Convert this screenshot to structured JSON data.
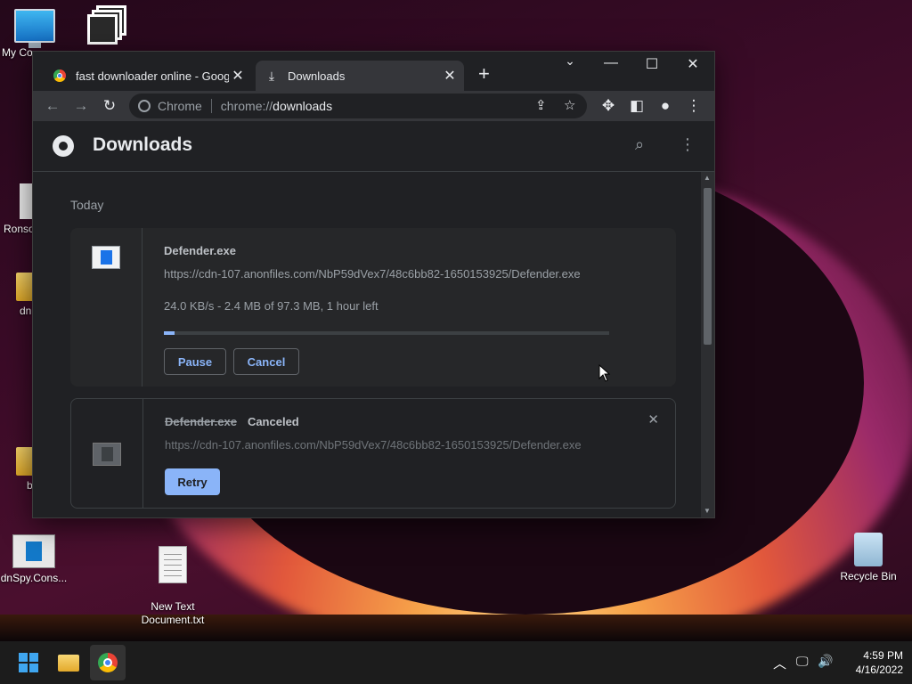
{
  "desktop": {
    "icons": [
      {
        "label": "My Co"
      },
      {
        "label": ""
      },
      {
        "label": "Ronso"
      },
      {
        "label": "dn"
      },
      {
        "label": "b"
      },
      {
        "label": "dnSpy.Cons..."
      },
      {
        "label": "New Text\nDocument.txt"
      },
      {
        "label": "Recycle Bin"
      }
    ]
  },
  "browser": {
    "tabs": [
      {
        "title": "fast downloader online - Google",
        "icon": "google-icon"
      },
      {
        "title": "Downloads",
        "icon": "download-icon"
      }
    ],
    "omnibox": {
      "site": "Chrome",
      "url_prefix": "chrome://",
      "url_path": "downloads"
    }
  },
  "downloads_page": {
    "title": "Downloads",
    "section": "Today",
    "items": [
      {
        "filename": "Defender.exe",
        "url": "https://cdn-107.anonfiles.com/NbP59dVex7/48c6bb82-1650153925/Defender.exe",
        "status": "24.0 KB/s - 2.4 MB of 97.3 MB, 1 hour left",
        "progress_fraction": 0.0247,
        "buttons": {
          "pause": "Pause",
          "cancel": "Cancel"
        }
      },
      {
        "filename": "Defender.exe",
        "state": "Canceled",
        "url": "https://cdn-107.anonfiles.com/NbP59dVex7/48c6bb82-1650153925/Defender.exe",
        "buttons": {
          "retry": "Retry"
        }
      }
    ]
  },
  "taskbar": {
    "time": "4:59 PM",
    "date": "4/16/2022"
  },
  "colors": {
    "accent": "#8ab4f8",
    "page_bg": "#202124",
    "toolbar_bg": "#35363a"
  }
}
